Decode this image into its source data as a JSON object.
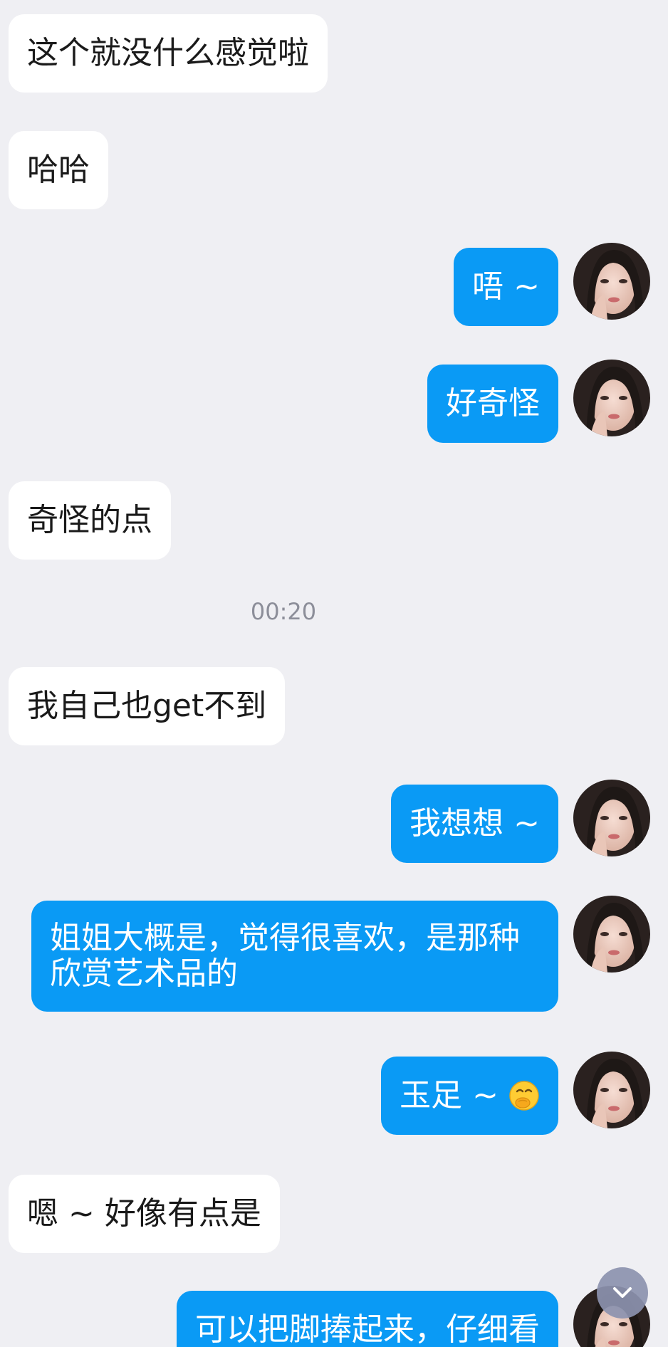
{
  "messages": [
    {
      "side": "incoming",
      "text": "这个就没什么感觉啦"
    },
    {
      "side": "incoming",
      "text": "哈哈"
    },
    {
      "side": "outgoing",
      "text": "唔 ~"
    },
    {
      "side": "outgoing",
      "text": "好奇怪"
    },
    {
      "side": "incoming",
      "text": "奇怪的点"
    },
    {
      "side": "time",
      "text": "00:20"
    },
    {
      "side": "incoming",
      "text": "我自己也get不到"
    },
    {
      "side": "outgoing",
      "text": "我想想 ~"
    },
    {
      "side": "outgoing",
      "text": "姐姐大概是，觉得很喜欢，是那种欣赏艺术品的"
    },
    {
      "side": "outgoing",
      "text": "玉足 ~",
      "emoji": "face-with-hand-over-mouth"
    },
    {
      "side": "incoming",
      "text": "嗯 ~ 好像有点是"
    },
    {
      "side": "outgoing",
      "text": "可以把脚捧起来，仔细看"
    }
  ],
  "colors": {
    "background": "#efeff3",
    "incoming_bubble": "#ffffff",
    "outgoing_bubble": "#0a9af5",
    "timestamp_text": "#8c8e99"
  },
  "icons": {
    "avatar": "user-avatar",
    "scroll": "chevron-down-icon"
  }
}
